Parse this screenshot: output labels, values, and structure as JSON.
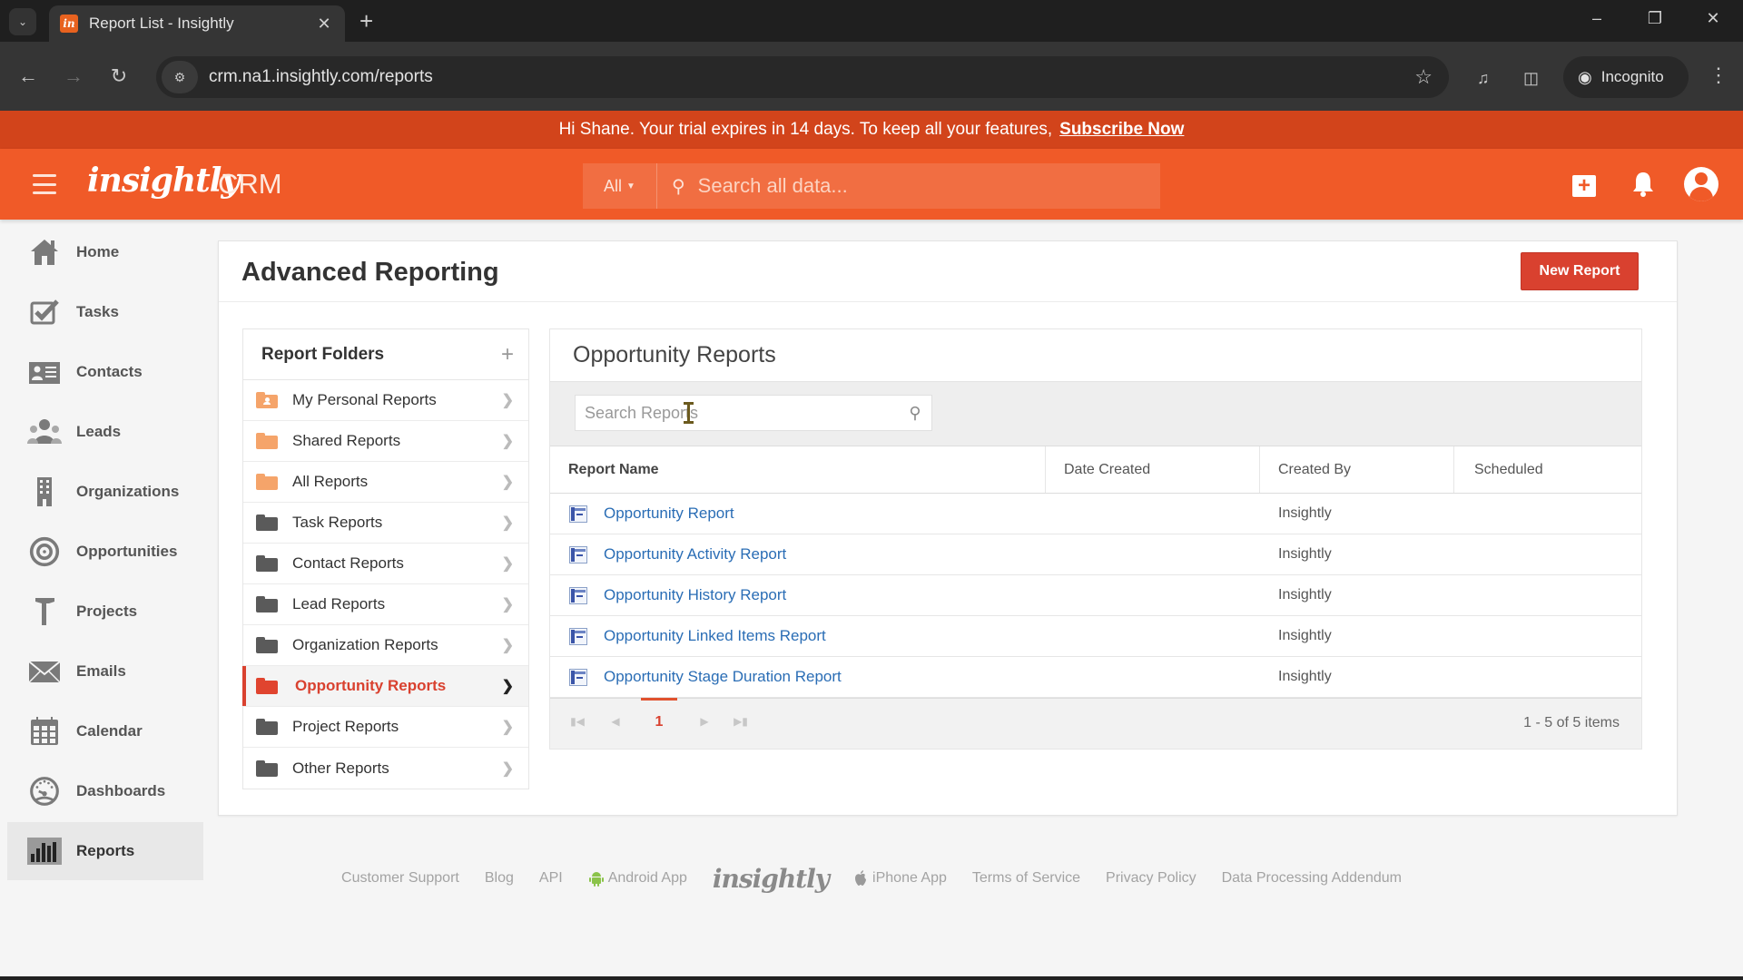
{
  "browser": {
    "tab_title": "Report List - Insightly",
    "favicon_text": "in",
    "url": "crm.na1.insightly.com/reports",
    "incognito_label": "Incognito"
  },
  "banner": {
    "message": "Hi Shane. Your trial expires in 14 days. To keep all your features,",
    "link": "Subscribe Now"
  },
  "header": {
    "logo": "insightly",
    "product": "CRM",
    "search_scope": "All",
    "search_placeholder": "Search all data...",
    "brand_color": "#f05a28"
  },
  "nav": {
    "items": [
      {
        "label": "Home",
        "icon": "home-icon"
      },
      {
        "label": "Tasks",
        "icon": "tasks-checkbox-icon"
      },
      {
        "label": "Contacts",
        "icon": "contact-card-icon"
      },
      {
        "label": "Leads",
        "icon": "leads-people-icon"
      },
      {
        "label": "Organizations",
        "icon": "building-icon"
      },
      {
        "label": "Opportunities",
        "icon": "target-icon"
      },
      {
        "label": "Projects",
        "icon": "hammer-icon"
      },
      {
        "label": "Emails",
        "icon": "envelope-icon"
      },
      {
        "label": "Calendar",
        "icon": "calendar-icon"
      },
      {
        "label": "Dashboards",
        "icon": "gauge-icon"
      },
      {
        "label": "Reports",
        "icon": "bar-chart-icon",
        "active": true
      }
    ]
  },
  "page": {
    "title": "Advanced Reporting",
    "new_report_label": "New Report"
  },
  "folders": {
    "title": "Report Folders",
    "items": [
      {
        "label": "My Personal Reports",
        "type": "personal"
      },
      {
        "label": "Shared Reports",
        "type": "orange"
      },
      {
        "label": "All Reports",
        "type": "orange"
      },
      {
        "label": "Task Reports",
        "type": "dark"
      },
      {
        "label": "Contact Reports",
        "type": "dark"
      },
      {
        "label": "Lead Reports",
        "type": "dark"
      },
      {
        "label": "Organization Reports",
        "type": "dark"
      },
      {
        "label": "Opportunity Reports",
        "type": "active"
      },
      {
        "label": "Project Reports",
        "type": "dark"
      },
      {
        "label": "Other Reports",
        "type": "dark"
      }
    ]
  },
  "reports": {
    "title": "Opportunity Reports",
    "search_placeholder": "Search Reports",
    "search_value": "",
    "columns": [
      "Report Name",
      "Date Created",
      "Created By",
      "Scheduled"
    ],
    "rows": [
      {
        "name": "Opportunity Report",
        "date_created": "",
        "created_by": "Insightly",
        "scheduled": ""
      },
      {
        "name": "Opportunity Activity Report",
        "date_created": "",
        "created_by": "Insightly",
        "scheduled": ""
      },
      {
        "name": "Opportunity History Report",
        "date_created": "",
        "created_by": "Insightly",
        "scheduled": ""
      },
      {
        "name": "Opportunity Linked Items Report",
        "date_created": "",
        "created_by": "Insightly",
        "scheduled": ""
      },
      {
        "name": "Opportunity Stage Duration Report",
        "date_created": "",
        "created_by": "Insightly",
        "scheduled": ""
      }
    ],
    "pager": {
      "current_page": "1",
      "info": "1 - 5 of 5 items"
    }
  },
  "footer": {
    "links": [
      "Customer Support",
      "Blog",
      "API",
      "Android App",
      "iPhone App",
      "Terms of Service",
      "Privacy Policy",
      "Data Processing Addendum"
    ],
    "logo": "insightly"
  }
}
